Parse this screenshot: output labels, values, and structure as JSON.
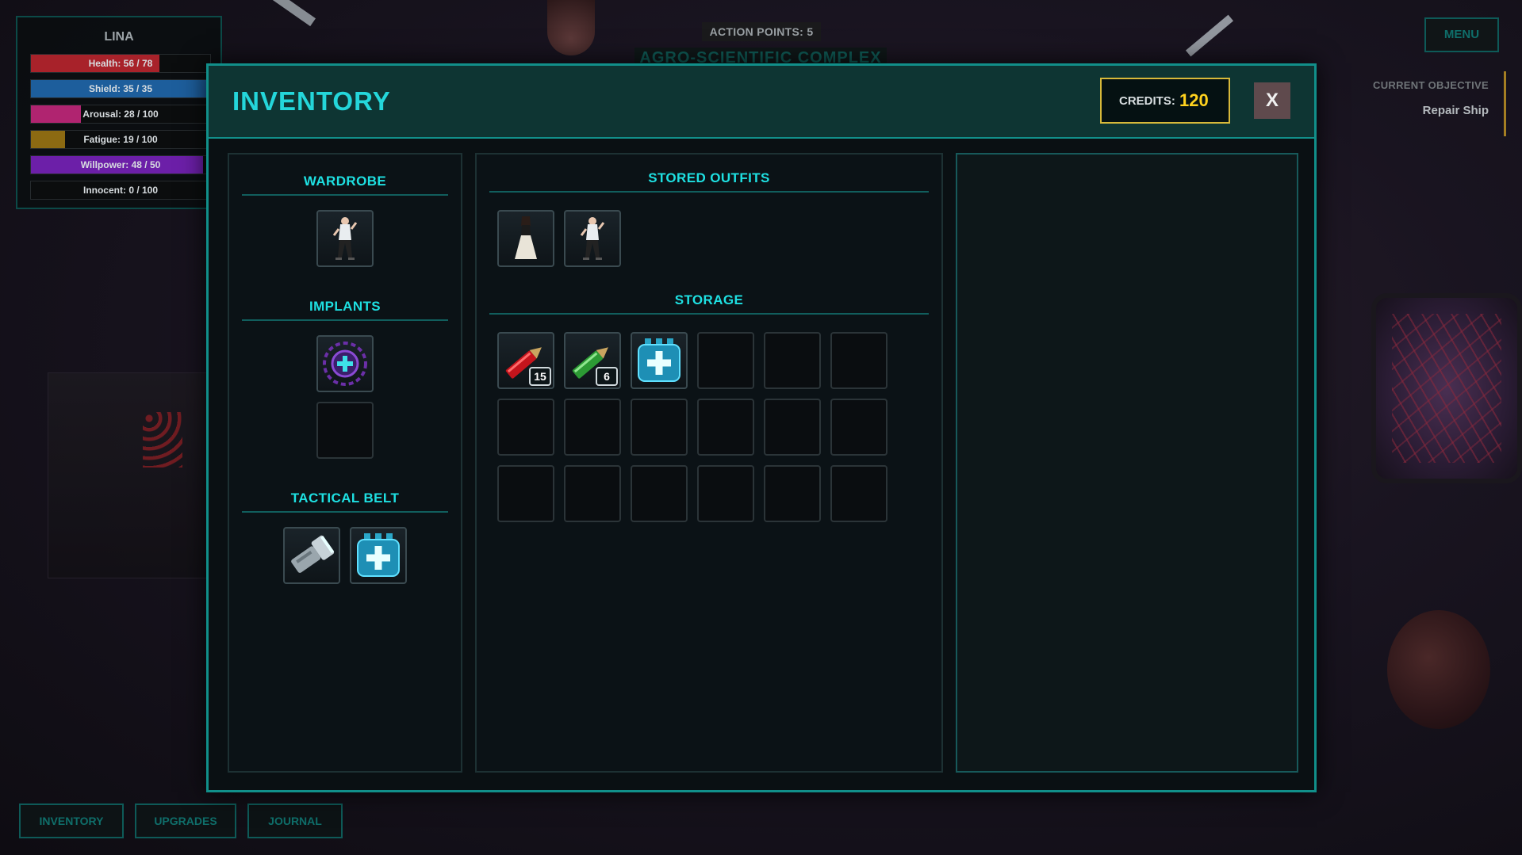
{
  "hud": {
    "action_points": "ACTION POINTS: 5",
    "location": "AGRO-SCIENTIFIC COMPLEX",
    "menu_label": "MENU",
    "objective_label": "CURRENT OBJECTIVE",
    "objective_value": "Repair Ship"
  },
  "character": {
    "name": "LINA",
    "stats": [
      {
        "label": "Health: 56 / 78",
        "fraction": 0.718,
        "color": "#a8222a"
      },
      {
        "label": "Shield: 35 / 35",
        "fraction": 1.0,
        "color": "#1d5e9c"
      },
      {
        "label": "Arousal: 28 / 100",
        "fraction": 0.28,
        "color": "#b02470"
      },
      {
        "label": "Fatigue: 19 / 100",
        "fraction": 0.19,
        "color": "#8c6a12"
      },
      {
        "label": "Willpower: 48 / 50",
        "fraction": 0.96,
        "color": "#6c1fa8"
      },
      {
        "label": "Innocent: 0 / 100",
        "fraction": 0.0,
        "color": "#c8c8c8"
      }
    ]
  },
  "bottom_tabs": [
    "INVENTORY",
    "UPGRADES",
    "JOURNAL"
  ],
  "inventory": {
    "title": "INVENTORY",
    "credits_label": "CREDITS:",
    "credits_value": "120",
    "close_label": "X",
    "sections": {
      "wardrobe": "WARDROBE",
      "implants": "IMPLANTS",
      "tactical_belt": "TACTICAL BELT",
      "stored_outfits": "STORED OUTFITS",
      "storage": "STORAGE"
    },
    "wardrobe_items": [
      "outfit-icon"
    ],
    "implant_slots": [
      "implant-icon",
      null
    ],
    "belt_items": [
      "flashlight-icon",
      "medkit-icon"
    ],
    "stored_outfits": [
      "dress-outfit-icon",
      "outfit-icon"
    ],
    "storage_items": [
      {
        "icon": "red-ammo-icon",
        "count": "15"
      },
      {
        "icon": "green-ammo-icon",
        "count": "6"
      },
      {
        "icon": "medkit-icon",
        "count": null
      }
    ],
    "storage_slot_count": 18
  }
}
